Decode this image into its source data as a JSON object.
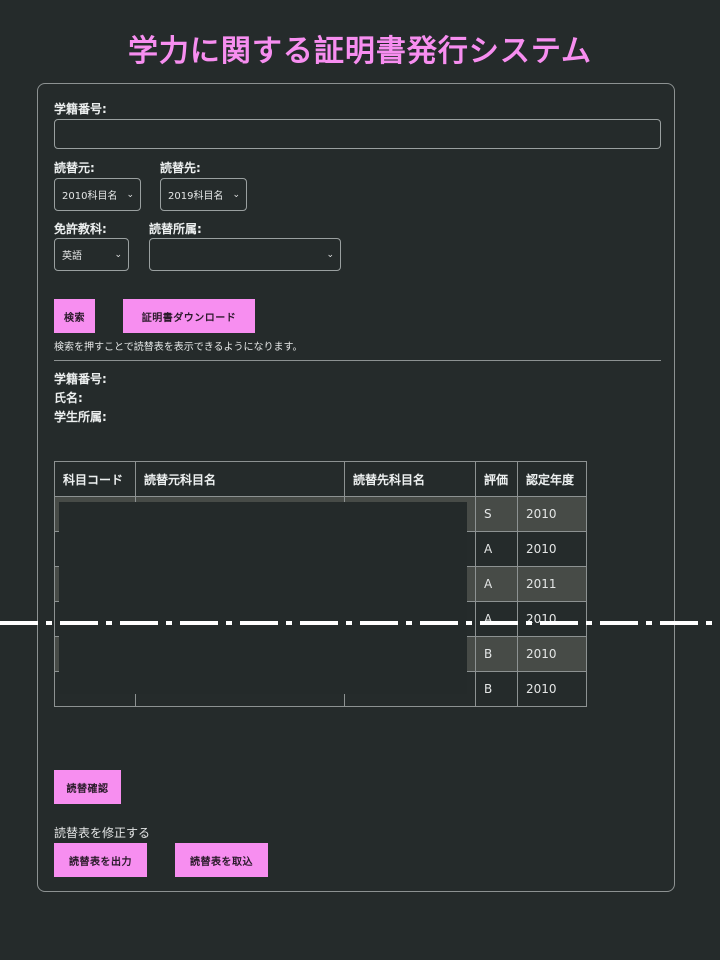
{
  "app": {
    "title": "学力に関する証明書発行システム",
    "accent_color": "#f78ef0",
    "background_color": "#252b2b"
  },
  "form": {
    "student_id_label": "学籍番号:",
    "student_id_value": "",
    "source_label": "読替元:",
    "source_value": "2010科目名",
    "target_label": "読替先:",
    "target_value": "2019科目名",
    "license_label": "免許教科:",
    "license_value": "英語",
    "affiliation_label": "読替所属:",
    "affiliation_value": ""
  },
  "buttons": {
    "search": "検索",
    "download": "証明書ダウンロード",
    "confirm": "読替確認",
    "export": "読替表を出力",
    "import": "読替表を取込"
  },
  "hint_text": "検索を押すことで読替表を表示できるようになります。",
  "student_info": {
    "id_label": "学籍番号:",
    "name_label": "氏名:",
    "affiliation_label": "学生所属:"
  },
  "table": {
    "headers": [
      "科目コード",
      "読替元科目名",
      "読替先科目名",
      "評価",
      "認定年度"
    ],
    "rows": [
      {
        "grade": "S",
        "year": "2010"
      },
      {
        "grade": "A",
        "year": "2010"
      },
      {
        "grade": "A",
        "year": "2011"
      },
      {
        "grade": "A",
        "year": "2010"
      },
      {
        "grade": "B",
        "year": "2010"
      },
      {
        "grade": "B",
        "year": "2010"
      }
    ]
  },
  "modify_label": "読替表を修正する"
}
